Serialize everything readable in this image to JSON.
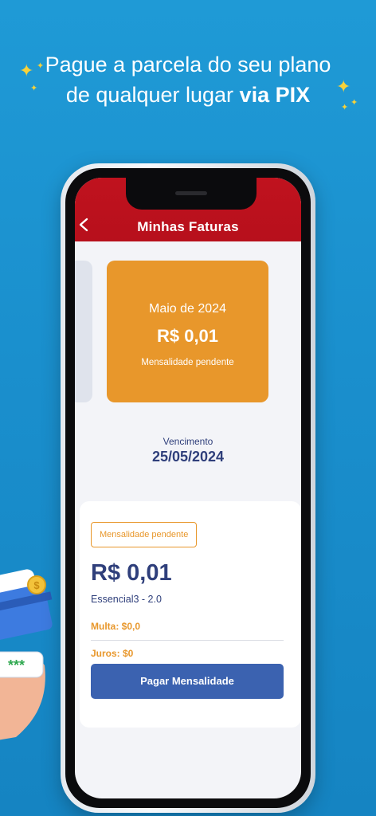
{
  "promo": {
    "line1": "Pague a parcela do seu plano",
    "line2_prefix": "de qualquer lugar ",
    "line2_emphasis": "via PIX"
  },
  "app": {
    "title": "Minhas Faturas"
  },
  "invoice_card": {
    "month": "Maio de 2024",
    "amount": "R$ 0,01",
    "status": "Mensalidade pendente"
  },
  "due": {
    "label": "Vencimento",
    "date": "25/05/2024"
  },
  "detail": {
    "badge": "Mensalidade pendente",
    "amount": "R$ 0,01",
    "plan": "Essencial3 - 2.0",
    "multa": "Multa: $0,0",
    "juros": "Juros: $0",
    "pay_button": "Pagar Mensalidade"
  },
  "illustration": {
    "coin_symbol": "$",
    "pin_mask": "***"
  },
  "colors": {
    "background": "#1a8fcd",
    "header_red": "#c0121e",
    "accent_orange": "#e8972b",
    "navy_text": "#2f3f7b",
    "button_blue": "#3b62b0",
    "sparkle_yellow": "#f7d23a"
  }
}
